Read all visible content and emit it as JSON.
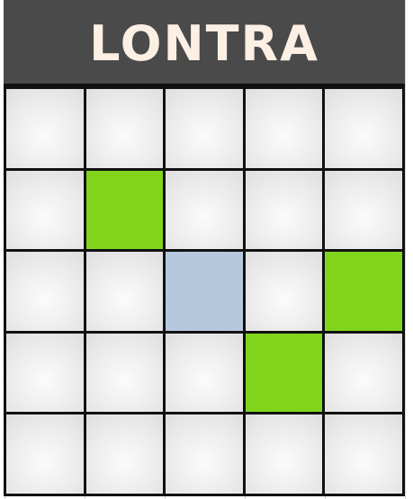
{
  "card": {
    "title": "LONTRA"
  },
  "board": {
    "rows": 5,
    "cols": 5,
    "cells": [
      [
        "empty",
        "empty",
        "empty",
        "empty",
        "empty"
      ],
      [
        "empty",
        "marked",
        "empty",
        "empty",
        "empty"
      ],
      [
        "empty",
        "empty",
        "free",
        "empty",
        "marked"
      ],
      [
        "empty",
        "empty",
        "empty",
        "marked",
        "empty"
      ],
      [
        "empty",
        "empty",
        "empty",
        "empty",
        "empty"
      ]
    ]
  },
  "colors": {
    "title_bg": "#4a4a4a",
    "title_text": "#fcefe4",
    "marked": "#80d51c",
    "free": "#b6c8de",
    "grid_line": "#111111"
  }
}
